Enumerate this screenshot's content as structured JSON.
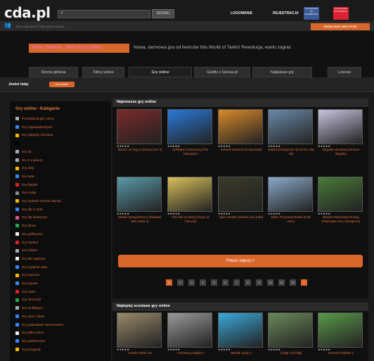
{
  "header": {
    "logo": "cda.pl",
    "search_button": "SZUKAJ",
    "login": "LOGOWANIE",
    "register": "REJESTRACJA",
    "facebook": "POLUB NAS NA FACEBOOKU",
    "google": "POLUB NAS NA GOOGLE+",
    "subbar_text": "Jest w cda teraz 17206 osób na stronie",
    "app_button": "DODAJ NAS JAKO PLIKI"
  },
  "promo": {
    "tag": "Rtaile / Rtailsow - Nowy hit po polsku!",
    "text": "Nowa, darmowa gra od twórców hitu World of Tanks! Rewolucja, warto zagrać"
  },
  "tabs": [
    "Strona główna",
    "Filmy wideo",
    "Gry online",
    "Grafiki z Gnesa.pl",
    "Najlepsze gry",
    "Losowe"
  ],
  "active_tab": 2,
  "filter": {
    "label": "Jesteś tutaj:",
    "pill": "Gry online"
  },
  "sidebar": {
    "title": "Gry online - Kategorie",
    "items": [
      {
        "label": "Poczekalnia gier online",
        "color": "#aaaaaa"
      },
      {
        "label": "Gry najpopularniejsze",
        "color": "#3b82f6"
      },
      {
        "label": "Gry najlepiej oceniane",
        "color": "#f5b800"
      },
      {
        "label": "",
        "color": "#000000"
      },
      {
        "label": "Gry 3d",
        "color": "#aaaaaa"
      },
      {
        "label": "Gry 2 w graczy",
        "color": "#aaaaaa"
      },
      {
        "label": "Gry akcji",
        "color": "#f5b800"
      },
      {
        "label": "Gry auta",
        "color": "#3b82f6"
      },
      {
        "label": "Gry bijatyki",
        "color": "#e02020"
      },
      {
        "label": "Gry czołgi",
        "color": "#888888"
      },
      {
        "label": "Gry dodanie (strzela więcej)",
        "color": "#f5b800"
      },
      {
        "label": "Gry dla 2 osób",
        "color": "#3b82f6"
      },
      {
        "label": "Gry dla dziewczyn",
        "color": "#e05090"
      },
      {
        "label": "Gry farma",
        "color": "#22aa44"
      },
      {
        "label": "Gry golf/ważne",
        "color": "#eeeeee"
      },
      {
        "label": "Gry hacked",
        "color": "#e02020"
      },
      {
        "label": "Gry hidden",
        "color": "#aaaaaa"
      },
      {
        "label": "Gry jak napisane",
        "color": "#eeeeee"
      },
      {
        "label": "Gry kopalnia złota",
        "color": "#3b82f6"
      },
      {
        "label": "Gry logiczne",
        "color": "#f5b800"
      },
      {
        "label": "Gry logowe",
        "color": "#3b82f6"
      },
      {
        "label": "Gry mario",
        "color": "#e02020"
      },
      {
        "label": "Gry minecraft",
        "color": "#22aa44"
      },
      {
        "label": "Gry multiplayer",
        "color": "#aaaaaa"
      },
      {
        "label": "Gry sport i wiele",
        "color": "#3b82f6"
      },
      {
        "label": "Gry parkowanie samochodem",
        "color": "#3b82f6"
      },
      {
        "label": "Gry piłka nożna",
        "color": "#eeeeee"
      },
      {
        "label": "Gry platformowe",
        "color": "#3b82f6"
      },
      {
        "label": "Gry przygody",
        "color": "#f5b800"
      }
    ]
  },
  "panel1": {
    "title": "Najnowsze gry online",
    "games": [
      {
        "title": "Bokson na ringu 2 (Boxing Live 2)",
        "bg": "#7a2a2a",
        "stars": "★★★★★"
      },
      {
        "title": "Helikopter Ratowniczy (Fire Helicopter)",
        "bg": "#2a7ad9",
        "stars": "★★★★★"
      },
      {
        "title": "Kelnerki Jedzenie (Heavy Eats)",
        "bg": "#d98a2a",
        "stars": "★★★★★"
      },
      {
        "title": "Miasto przestępców 3D (Crime City 3D)",
        "bg": "#6a8aa9",
        "stars": "★★★★★"
      },
      {
        "title": "Brygada ratunkowa (Rescue Brigade)",
        "bg": "#c8c4e0",
        "stars": "★★★★★"
      },
      {
        "title": "Maszki Sprawdzenia 4 (Shaaster With Strike 4)",
        "bg": "#5a9aa9",
        "stars": "★★★★★"
      },
      {
        "title": "Palczaki na zatoki (Finger vs Tanneck)",
        "bg": "#d9c05a",
        "stars": "★★★★★"
      },
      {
        "title": "Julia i Zombie (Zombie and Juliet)",
        "bg": "#3a3a2a",
        "stars": "★★★★★"
      },
      {
        "title": "Mistrz Trzymania Rakiet (Knife Hero)",
        "bg": "#8aa9c9",
        "stars": "★★★★★"
      },
      {
        "title": "Wesołe Mistrzostwa Europy (Playmaker Euro Champions)",
        "bg": "#4a7a3a",
        "stars": "★★★★★"
      }
    ],
    "more_button": "Pokaż więcej >",
    "pages": [
      "1",
      "2",
      "3",
      "4",
      "5",
      "6",
      "7",
      "8",
      "9",
      "10",
      "11",
      "12",
      "»"
    ],
    "current_page": 0
  },
  "panel2": {
    "title": "Najlepiej oceniane gry online",
    "games": [
      {
        "title": "Counter Strike Jar",
        "bg": "#9a8a6a",
        "stars": "★★★★★"
      },
      {
        "title": "Czerwona pułapka 2",
        "bg": "#9a9a9a",
        "stars": "★★★★★"
      },
      {
        "title": "Wesołe Jazdy 3",
        "bg": "#3aa9d9",
        "stars": "★★★★★"
      },
      {
        "title": "Czołgi 3 (Czołgi)",
        "bg": "#6a8a5a",
        "stars": "★★★★★"
      },
      {
        "title": "Konsola Polaków 2",
        "bg": "#5a9a4a",
        "stars": "★★★★★"
      }
    ]
  }
}
